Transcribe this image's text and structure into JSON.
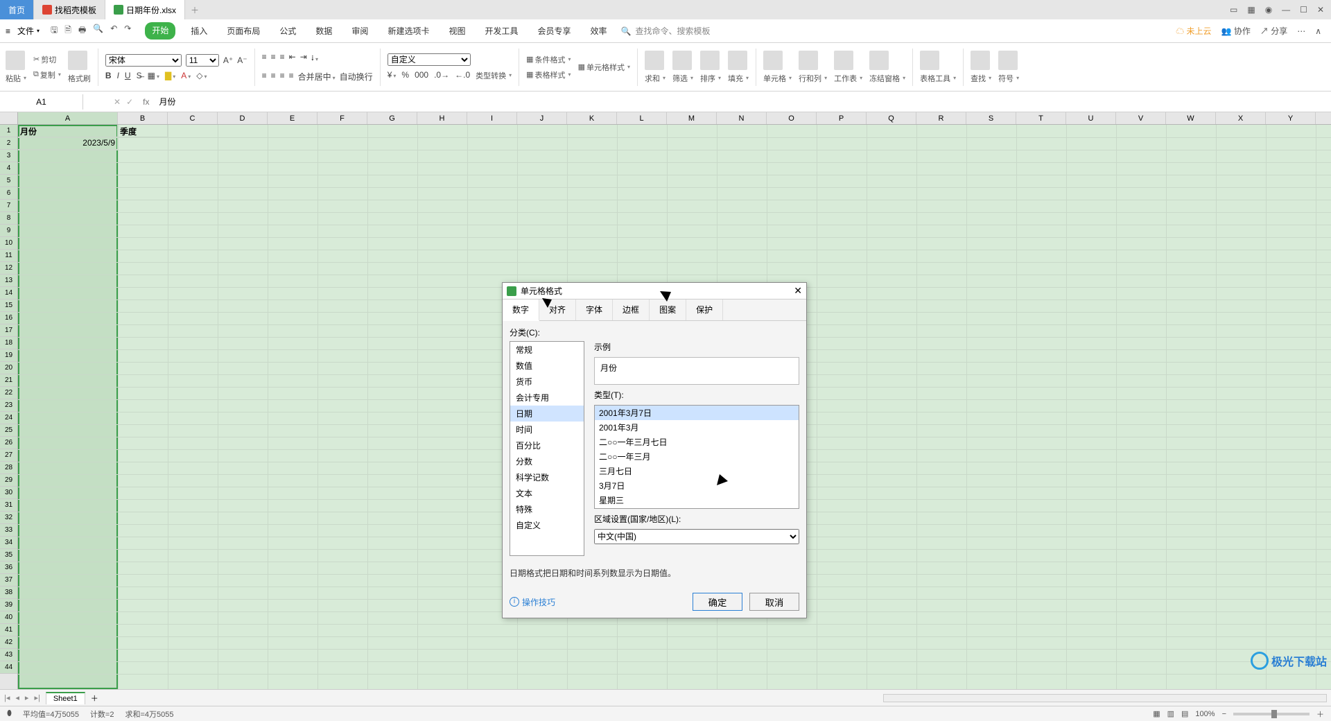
{
  "tabs": {
    "home": "首页",
    "template": "找稻壳模板",
    "file": "日期年份.xlsx"
  },
  "menu": {
    "file": "文件",
    "items": [
      "开始",
      "插入",
      "页面布局",
      "公式",
      "数据",
      "审阅",
      "新建选项卡",
      "视图",
      "开发工具",
      "会员专享",
      "效率"
    ],
    "search_placeholder": "查找命令、搜索模板",
    "cloud": "未上云",
    "coop": "协作",
    "share": "分享"
  },
  "ribbon": {
    "paste": "粘贴",
    "cut": "剪切",
    "copy": "复制",
    "fmtpaint": "格式刷",
    "font": "宋体",
    "size": "11",
    "merge": "合并居中",
    "wrap": "自动换行",
    "numfmt": "自定义",
    "typecvt": "类型转换",
    "condfmt": "条件格式",
    "tblstyle": "表格样式",
    "cellstyle": "单元格样式",
    "sum": "求和",
    "filter": "筛选",
    "sort": "排序",
    "fill": "填充",
    "cell": "单元格",
    "rowcol": "行和列",
    "sheet": "工作表",
    "freeze": "冻结窗格",
    "tbltools": "表格工具",
    "find": "查找",
    "symbol": "符号"
  },
  "fbar": {
    "ref": "A1",
    "fx": "fx",
    "value": "月份"
  },
  "columns": [
    "A",
    "B",
    "C",
    "D",
    "E",
    "F",
    "G",
    "H",
    "I",
    "J",
    "K",
    "L",
    "M",
    "N",
    "O",
    "P",
    "Q",
    "R",
    "S",
    "T",
    "U",
    "V",
    "W",
    "X",
    "Y"
  ],
  "cells": {
    "A1": "月份",
    "B1": "季度",
    "A2": "2023/5/9"
  },
  "dialog": {
    "title": "单元格格式",
    "tabs": [
      "数字",
      "对齐",
      "字体",
      "边框",
      "图案",
      "保护"
    ],
    "cat_label": "分类(C):",
    "categories": [
      "常规",
      "数值",
      "货币",
      "会计专用",
      "日期",
      "时间",
      "百分比",
      "分数",
      "科学记数",
      "文本",
      "特殊",
      "自定义"
    ],
    "cat_selected": "日期",
    "sample_label": "示例",
    "sample_value": "月份",
    "type_label": "类型(T):",
    "types": [
      "2001年3月7日",
      "2001年3月",
      "二○○一年三月七日",
      "二○○一年三月",
      "三月七日",
      "3月7日",
      "星期三"
    ],
    "type_selected": "2001年3月7日",
    "locale_label": "区域设置(国家/地区)(L):",
    "locale_value": "中文(中国)",
    "desc": "日期格式把日期和时间系列数显示为日期值。",
    "tips": "操作技巧",
    "ok": "确定",
    "cancel": "取消"
  },
  "sheet": {
    "name": "Sheet1"
  },
  "status": {
    "avg": "平均值=4万5055",
    "count": "计数=2",
    "sum": "求和=4万5055",
    "zoom": "100%"
  },
  "watermark": "极光下载站"
}
